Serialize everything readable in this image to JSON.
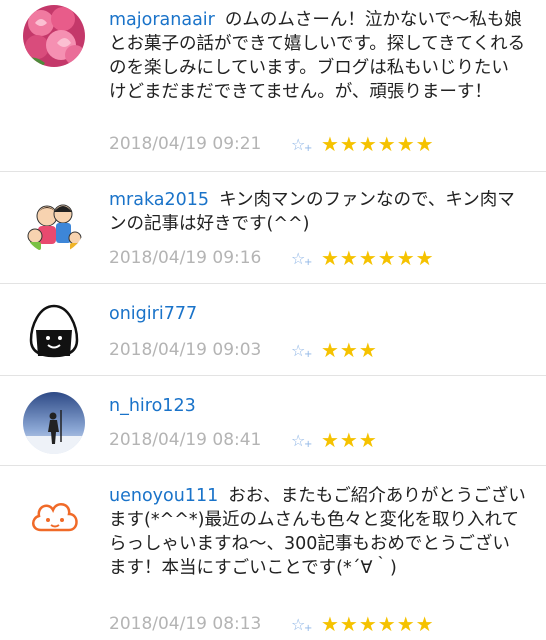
{
  "comments": [
    {
      "username": "majoranaair",
      "text": "のムのムさーん！泣かないで〜私も娘とお菓子の話ができて嬉しいです。探してきてくれるのを楽しみにしています。ブログは私もいじりたいけどまだまだできてません。が、頑張りまーす！",
      "timestamp": "2018/04/19 09:21",
      "stars": "★★★★★★",
      "avatar_icon": "roses-photo-icon"
    },
    {
      "username": "mraka2015",
      "text": "キン肉マンのファンなので、キン肉マンの記事は好きです(^^)",
      "timestamp": "2018/04/19 09:16",
      "stars": "★★★★★★",
      "avatar_icon": "family-illustration-icon"
    },
    {
      "username": "onigiri777",
      "text": "",
      "timestamp": "2018/04/19 09:03",
      "stars": "★★★",
      "avatar_icon": "onigiri-icon"
    },
    {
      "username": "n_hiro123",
      "text": "",
      "timestamp": "2018/04/19 08:41",
      "stars": "★★★",
      "avatar_icon": "skier-photo-icon"
    },
    {
      "username": "uenoyou111",
      "text": "おお、またもご紹介ありがとうございます(*^^*)最近のムさんも色々と変化を取り入れてらっしゃいますね〜、300記事もおめでとうございます！本当にすごいことです(*´∀｀)",
      "timestamp": "2018/04/19 08:13",
      "stars": "★★★★★★",
      "avatar_icon": "cloud-face-icon"
    }
  ],
  "add_star_icon": "add-star-icon",
  "colors": {
    "username": "#1a73c9",
    "star": "#f5c200",
    "timestamp": "#b4b4b4"
  }
}
